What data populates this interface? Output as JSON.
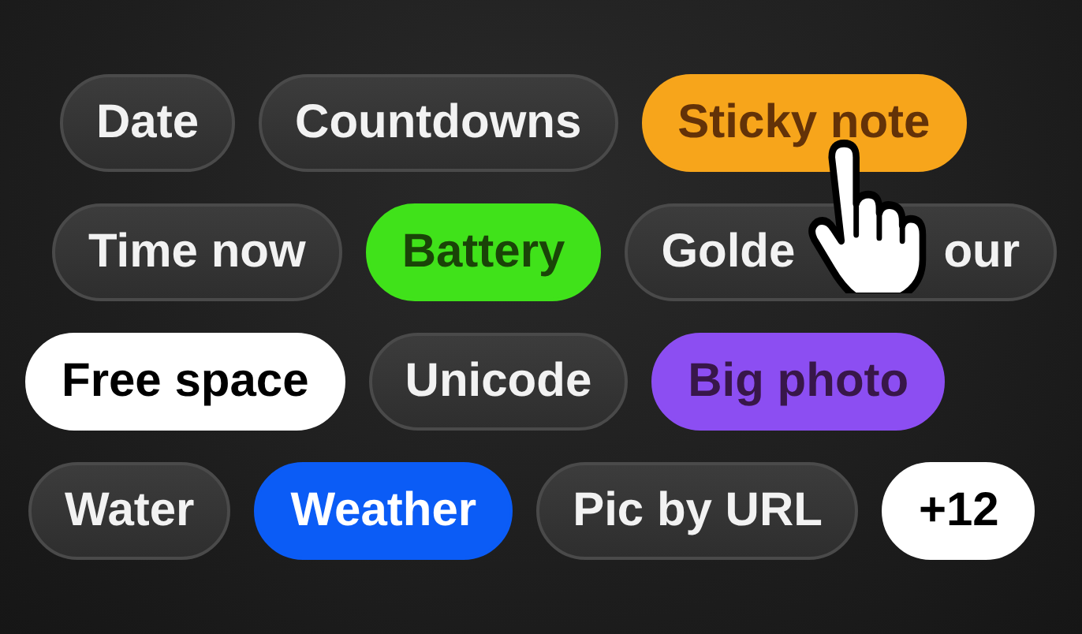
{
  "rows": [
    {
      "chips": [
        {
          "label": "Date"
        },
        {
          "label": "Countdowns"
        },
        {
          "label": "Sticky note",
          "color": "#f7a51b"
        }
      ]
    },
    {
      "chips": [
        {
          "label": "Time now"
        },
        {
          "label": "Battery",
          "color": "#40e21a"
        },
        {
          "label": "Golde",
          "label_end": "our"
        }
      ]
    },
    {
      "chips": [
        {
          "label": "Free space",
          "color": "#ffffff"
        },
        {
          "label": "Unicode"
        },
        {
          "label": "Big photo",
          "color": "#8c4ef2"
        }
      ]
    },
    {
      "chips": [
        {
          "label": "Water"
        },
        {
          "label": "Weather",
          "color": "#0b5cf6"
        },
        {
          "label": "Pic by URL"
        },
        {
          "label": "+12",
          "color": "#ffffff"
        }
      ]
    }
  ]
}
